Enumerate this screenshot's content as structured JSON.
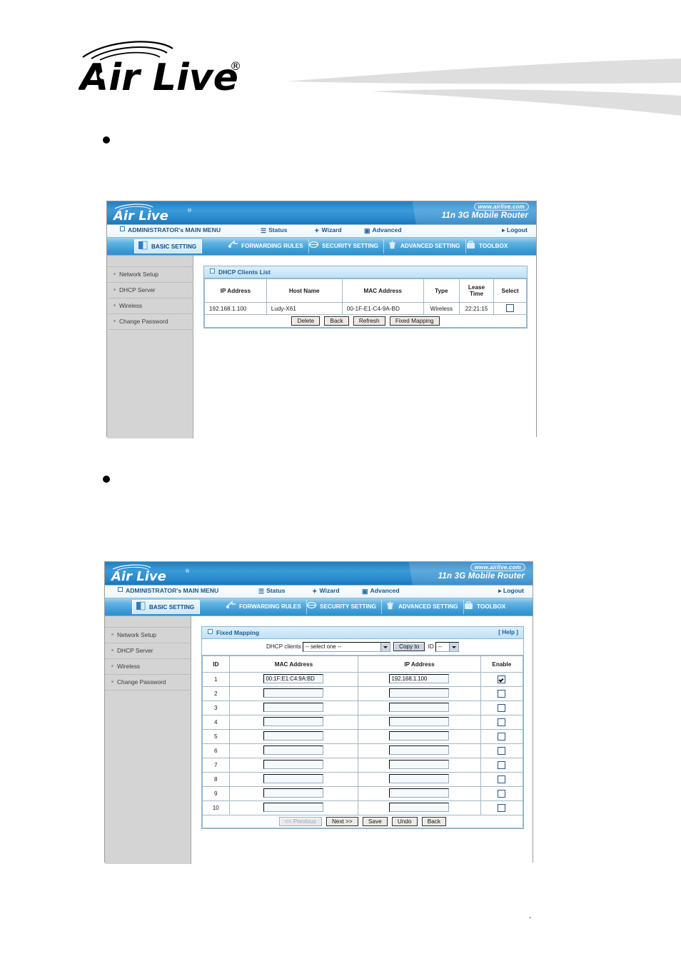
{
  "document": {
    "brand": "Air Live",
    "brand_registered": "®",
    "page_mark": ","
  },
  "router_ui": {
    "banner": {
      "logo_text": "Air Live",
      "url_badge": "www.airlive.com",
      "model": "11n 3G Mobile Router"
    },
    "menu": {
      "main_menu": "ADMINISTRATOR's MAIN MENU",
      "status": "Status",
      "wizard": "Wizard",
      "advanced": "Advanced",
      "logout": "Logout"
    },
    "tabs": [
      {
        "label": "BASIC SETTING",
        "icon": "book-icon",
        "active": true
      },
      {
        "label": "FORWARDING RULES",
        "icon": "arrows-icon",
        "active": false
      },
      {
        "label": "SECURITY SETTING",
        "icon": "shield-icon",
        "active": false
      },
      {
        "label": "ADVANCED SETTING",
        "icon": "tower-icon",
        "active": false
      },
      {
        "label": "TOOLBOX",
        "icon": "toolbox-icon",
        "active": false
      }
    ],
    "sidebar": [
      {
        "label": "Network Setup"
      },
      {
        "label": "DHCP Server"
      },
      {
        "label": "Wireless"
      },
      {
        "label": "Change Password"
      }
    ]
  },
  "figure1": {
    "panel_title": "DHCP Clients List",
    "columns": [
      "IP Address",
      "Host Name",
      "MAC Address",
      "Type",
      "Lease Time",
      "Select"
    ],
    "lease_time_line1": "Lease",
    "lease_time_line2": "Time",
    "rows": [
      {
        "ip_address": "192.168.1.100",
        "host_name": "Ludy-X61",
        "mac_address": "00-1F-E1-C4-9A-BD",
        "type": "Wireless",
        "lease_time": "22:21:15",
        "selected": false
      }
    ],
    "buttons": [
      {
        "label": "Delete",
        "disabled": false
      },
      {
        "label": "Back",
        "disabled": false
      },
      {
        "label": "Refresh",
        "disabled": false
      },
      {
        "label": "Fixed Mapping",
        "disabled": false
      }
    ]
  },
  "figure2": {
    "panel_title": "Fixed Mapping",
    "help_link": "[ Help ]",
    "dhcp_clients_label": "DHCP clients",
    "dhcp_clients_value": "-- select one --",
    "copy_to_label": "Copy to",
    "id_label": "ID",
    "id_value": "--",
    "columns": [
      "ID",
      "MAC Address",
      "IP Address",
      "Enable"
    ],
    "rows": [
      {
        "id": "1",
        "mac": "00:1F:E1:C4:9A:BD",
        "ip": "192.168.1.100",
        "enabled": true
      },
      {
        "id": "2",
        "mac": "",
        "ip": "",
        "enabled": false
      },
      {
        "id": "3",
        "mac": "",
        "ip": "",
        "enabled": false
      },
      {
        "id": "4",
        "mac": "",
        "ip": "",
        "enabled": false
      },
      {
        "id": "5",
        "mac": "",
        "ip": "",
        "enabled": false
      },
      {
        "id": "6",
        "mac": "",
        "ip": "",
        "enabled": false
      },
      {
        "id": "7",
        "mac": "",
        "ip": "",
        "enabled": false
      },
      {
        "id": "8",
        "mac": "",
        "ip": "",
        "enabled": false
      },
      {
        "id": "9",
        "mac": "",
        "ip": "",
        "enabled": false
      },
      {
        "id": "10",
        "mac": "",
        "ip": "",
        "enabled": false
      }
    ],
    "buttons": [
      {
        "label": "<< Previous",
        "disabled": true
      },
      {
        "label": "Next >>",
        "disabled": false
      },
      {
        "label": "Save",
        "disabled": false
      },
      {
        "label": "Undo",
        "disabled": false
      },
      {
        "label": "Back",
        "disabled": false
      }
    ]
  },
  "colors": {
    "banner_blue": "#2b8ccd",
    "tab_blue": "#3d9cd6",
    "panel_border": "#86b4d4",
    "sidebar_gray": "#d4d4d4",
    "swoosh_gray": "#dcdcdc"
  }
}
